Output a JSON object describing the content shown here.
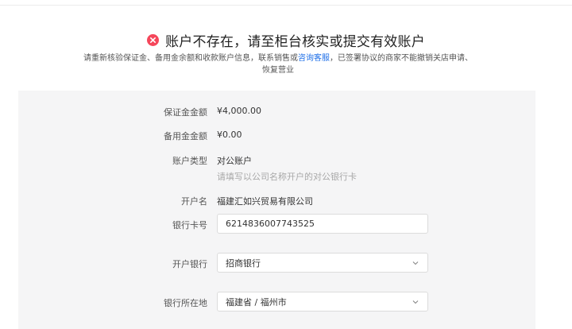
{
  "header": {
    "title": "账户不存在，请至柜台核实或提交有效账户",
    "desc_before": "请重新核验保证金、备用金余额和收款账户信息，联系销售或",
    "desc_link": "咨询客服",
    "desc_after": "，已签署协议的商家不能撤销关店申请、恢复营业"
  },
  "form": {
    "deposit": {
      "label": "保证金金额",
      "value": "¥4,000.00"
    },
    "reserve": {
      "label": "备用金金额",
      "value": "¥0.00"
    },
    "account_type": {
      "label": "账户类型",
      "value": "对公账户",
      "hint": "请填写以公司名称开户的对公银行卡"
    },
    "account_name": {
      "label": "开户名",
      "value": "福建汇如兴贸易有限公司"
    },
    "card_no": {
      "label": "银行卡号",
      "value": "6214836007743525"
    },
    "bank": {
      "label": "开户银行",
      "value": "招商银行"
    },
    "bank_location": {
      "label": "银行所在地",
      "value": "福建省 / 福州市"
    }
  },
  "icons": {
    "status": "error-circle-icon",
    "dropdown": "chevron-down-icon"
  },
  "colors": {
    "error": "#f5475b",
    "link": "#1e6fe8",
    "panel": "#f5f5f6"
  }
}
